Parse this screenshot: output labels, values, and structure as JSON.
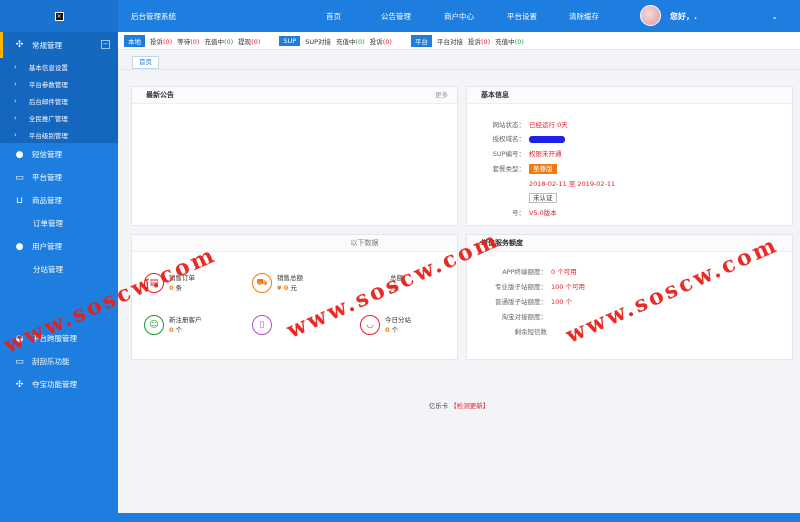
{
  "app": {
    "title": "后台管理系统"
  },
  "top_menu": [
    "首页",
    "公告管理",
    "商户中心",
    "平台设置",
    "清除缓存"
  ],
  "user": {
    "greeting": "您好，."
  },
  "sidebar": {
    "logo": "×",
    "active": {
      "label": "常规管理",
      "collapse": "−"
    },
    "subitems": [
      "基本信息设置",
      "平台参数管理",
      "后台邮件管理",
      "全民推广管理",
      "平台级别管理"
    ],
    "items": [
      "短信管理",
      "平台管理",
      "商品管理",
      "订单管理",
      "用户管理",
      "分站管理",
      "平台跨服管理",
      "刮刮乐功能",
      "夺宝功能管理"
    ]
  },
  "status": {
    "local": {
      "tag": "本地",
      "complaint_label": "投诉",
      "complaint": "(0)",
      "wait_label": "等待",
      "wait": "(0)",
      "recharge_label": "充值中",
      "recharge": "(0)",
      "withdraw_label": "提现",
      "withdraw": "(0)"
    },
    "sup": {
      "tag": "SUP",
      "dock_label": "SUP对接",
      "recharge_label": "充值中",
      "recharge": "(0)",
      "complaint_label": "投诉",
      "complaint": "(0)"
    },
    "platform": {
      "tag": "平台",
      "dock_label": "平台对接",
      "complaint_label": "投诉",
      "complaint": "(0)",
      "recharge_label": "充值中",
      "recharge": "(0)"
    }
  },
  "breadcrumb": "首页",
  "notice": {
    "title": "最新公告",
    "more": "更多"
  },
  "basic": {
    "title": "基本信息",
    "status_label": "网站状态：",
    "status_value": "已经运行 0天",
    "domain_label": "授权域名：",
    "sup_label": "SUP编号：",
    "sup_value": "权限未开通",
    "package_label": "套餐类型：",
    "package_value": "至尊版",
    "date_value": "2018-02-11 至 2019-02-11",
    "verify_btn": "未认证",
    "version_label": "号：",
    "version_value": "V5.0版本"
  },
  "data_panel": {
    "title": "以下数据",
    "stats": [
      {
        "label": "销售订单",
        "value": "0",
        "unit": "条"
      },
      {
        "label": "销售总额",
        "value": "¥ 0",
        "unit": "元"
      },
      {
        "label": "总额",
        "value": "",
        "unit": "元"
      },
      {
        "label": "新注册客户",
        "value": "0",
        "unit": "个"
      },
      {
        "label": "",
        "value": "",
        "unit": ""
      },
      {
        "label": "今日分站",
        "value": "0",
        "unit": "个"
      }
    ]
  },
  "value_added": {
    "title": "增值服务额度",
    "rows": [
      {
        "label": "APP终端额度：",
        "value": "0 个可用"
      },
      {
        "label": "专业版子站额度：",
        "value": "100 个可用"
      },
      {
        "label": "普通版子站额度：",
        "value": "100 个"
      },
      {
        "label": "淘宝对接额度：",
        "value": ""
      },
      {
        "label": "剩余短信数",
        "value": ""
      }
    ]
  },
  "footer": {
    "name": "亿乐卡",
    "link": "【检测更新】"
  },
  "watermark": "www.soscw.com",
  "colors": {
    "primary": "#1e7ee0",
    "red": "#e4202a",
    "green": "#1a9a37",
    "orange": "#f07a14"
  }
}
